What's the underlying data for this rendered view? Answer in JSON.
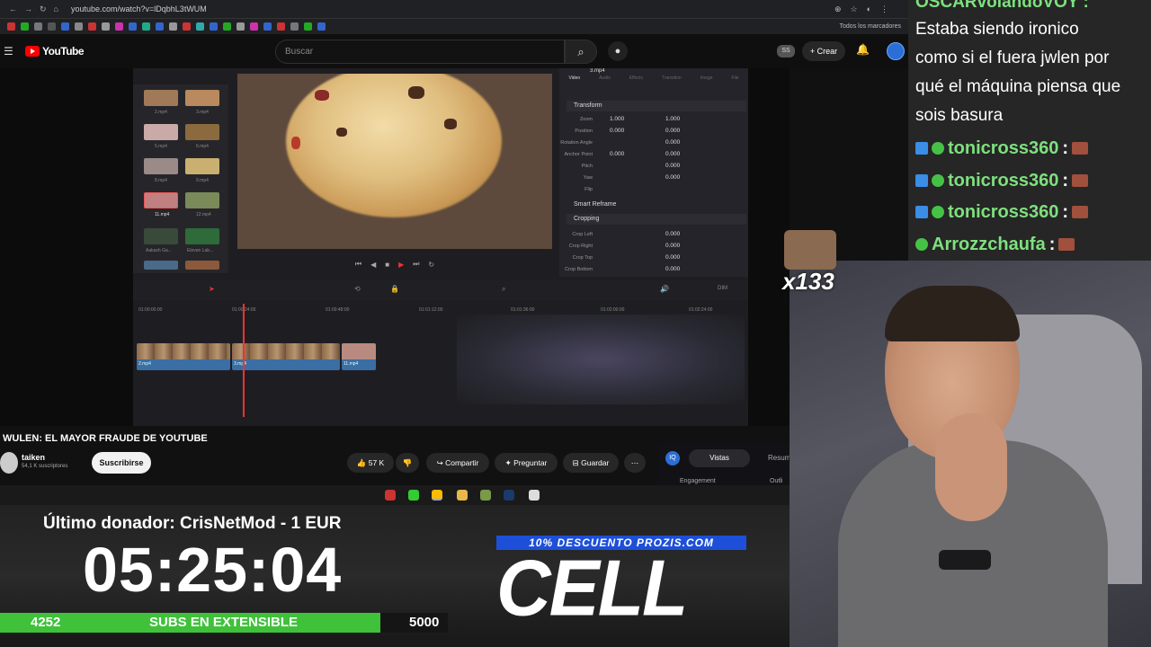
{
  "browser": {
    "url": "youtube.com/watch?v=lDqbhL3tWUM",
    "bookmarks_all": "Todos los marcadores"
  },
  "youtube": {
    "logo_text": "YouTube",
    "search_placeholder": "Buscar",
    "badge": "SS",
    "create_label": "Crear"
  },
  "resolve": {
    "inspector_title": "3.mp4",
    "tabs": [
      "Video",
      "Audio",
      "Effects",
      "Transition",
      "Image",
      "File"
    ],
    "sections": {
      "transform": "Transform",
      "smart_reframe": "Smart Reframe",
      "cropping": "Cropping"
    },
    "transform_rows": [
      {
        "label": "Zoom",
        "x": "1.000",
        "y": "1.000"
      },
      {
        "label": "Position",
        "x": "0.000",
        "y": "0.000"
      },
      {
        "label": "Rotation Angle",
        "x": "",
        "y": "0.000"
      },
      {
        "label": "Anchor Point",
        "x": "0.000",
        "y": "0.000"
      },
      {
        "label": "Pitch",
        "x": "",
        "y": "0.000"
      },
      {
        "label": "Yaw",
        "x": "",
        "y": "0.000"
      },
      {
        "label": "Flip",
        "x": "",
        "y": ""
      }
    ],
    "crop_rows": [
      {
        "label": "Crop Left",
        "value": "0.000"
      },
      {
        "label": "Crop Right",
        "value": "0.000"
      },
      {
        "label": "Crop Top",
        "value": "0.000"
      },
      {
        "label": "Crop Bottom",
        "value": "0.000"
      }
    ],
    "media_labels": [
      "2.mp4",
      "3.mp4",
      "5.mp4",
      "6.mp4",
      "8.mp4",
      "9.mp4",
      "11.mp4",
      "12.mp4",
      "Aakash Ga...",
      "Eleven Lab..."
    ],
    "ruler": [
      "01:00:00:00",
      "01:00:24:00",
      "01:00:48:00",
      "01:01:12:00",
      "01:01:36:00",
      "01:02:00:00",
      "01:02:24:00"
    ],
    "clips": [
      "2.mp4",
      "3.mp4",
      "11.mp4"
    ],
    "dim_label": "DIM"
  },
  "video_info": {
    "title": "WULEN: EL MAYOR FRAUDE DE YOUTUBE",
    "channel": "taiken",
    "subscribers": "54,1 K suscriptores",
    "subscribe_label": "Suscribirse",
    "likes": "57 K",
    "share_label": "Compartir",
    "ask_label": "Preguntar",
    "save_label": "Guardar",
    "panel_views": "Vistas",
    "panel_summary": "Resum",
    "panel_engagement": "Engagement",
    "panel_outline": "Outli"
  },
  "overlay": {
    "donor": "Último donador: CrisNetMod - 1 EUR",
    "timer": "05:25:04",
    "subs_current": "4252",
    "subs_label": "SUBS EN EXTENSIBLE",
    "subs_goal": "5000",
    "subs_progress": 0.85,
    "promo": "10% DESCUENTO PROZIS.COM",
    "sponsor": "CELL",
    "emote_count": "x133"
  },
  "chat": {
    "top_user": "OSCARvolandoVOY :",
    "message_lines": [
      "Estaba siendo ironico",
      "como si el fuera jwlen por",
      "qué el máquina piensa que",
      "sois basura"
    ],
    "entries": [
      {
        "user": "tonicross360"
      },
      {
        "user": "tonicross360"
      },
      {
        "user": "tonicross360"
      },
      {
        "user": "Arrozzchaufa"
      }
    ],
    "colon": ":"
  },
  "colors": {
    "accent_green": "#3fc13a",
    "promo_blue": "#1d4fd8",
    "chat_name": "#7ee07e",
    "playhead": "#e33333"
  }
}
